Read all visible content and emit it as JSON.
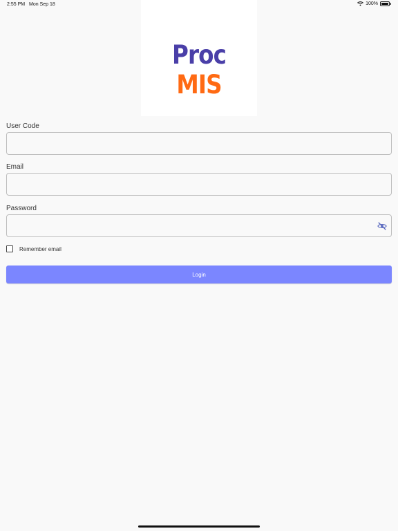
{
  "status_bar": {
    "time": "2:55 PM",
    "date": "Mon Sep 18",
    "battery": "100%"
  },
  "logo": {
    "part1": "Proc",
    "part2": "MIS",
    "colors": {
      "part1": "#4a3fa8",
      "part2": "#ff6a13"
    }
  },
  "form": {
    "user_code_label": "User Code",
    "user_code_value": "",
    "email_label": "Email",
    "email_value": "",
    "password_label": "Password",
    "password_value": "",
    "remember_label": "Remember email",
    "remember_checked": false,
    "login_label": "Login"
  },
  "colors": {
    "accent": "#7b86ff",
    "background": "#f9f9f9"
  },
  "icons": {
    "wifi": "wifi-icon",
    "battery": "battery-icon",
    "password_toggle": "eye-off-icon"
  }
}
